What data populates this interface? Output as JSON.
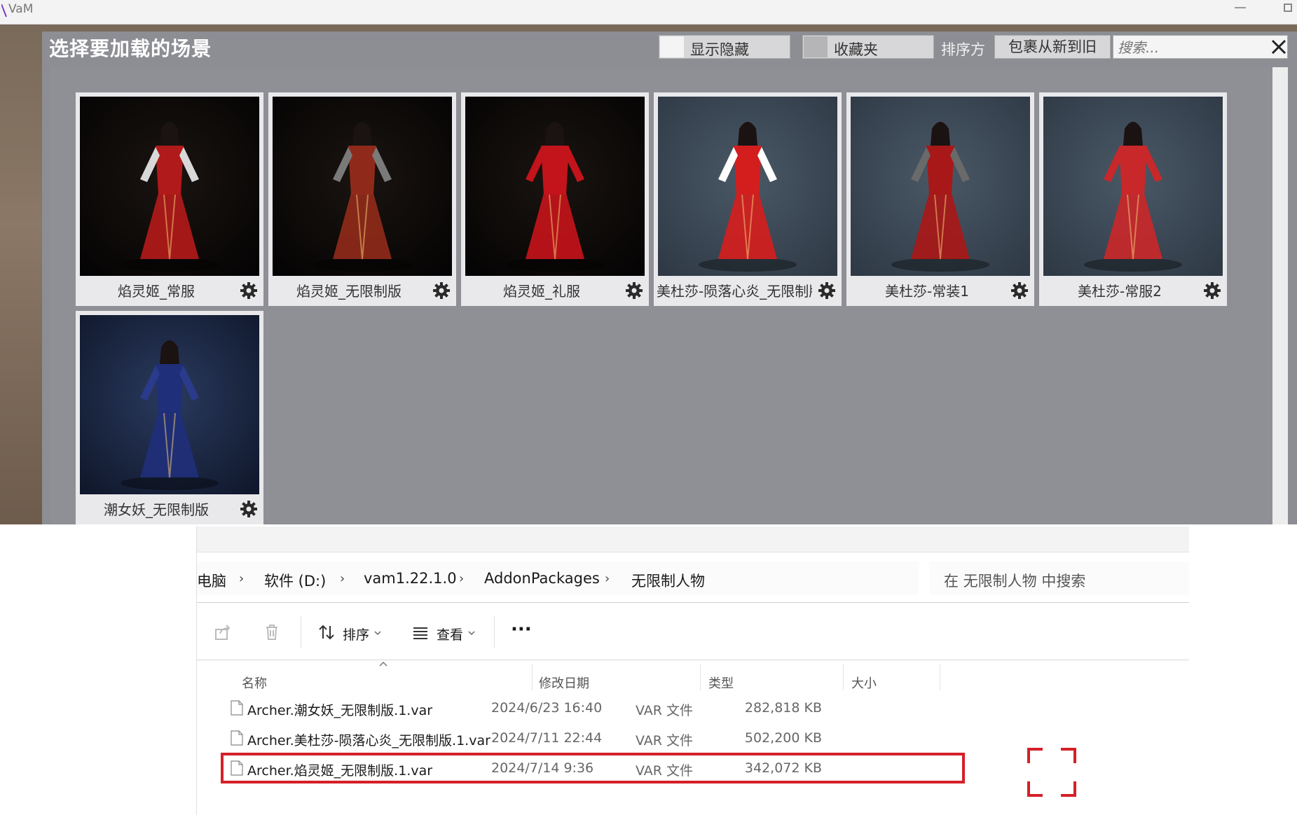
{
  "vam": {
    "window_title": "VaM",
    "panel_title": "选择要加载的场景",
    "toggles": [
      {
        "label": "显示隐藏"
      },
      {
        "label": "收藏夹"
      }
    ],
    "sort_caption": "排序方",
    "sort_value": "包裹从新到旧",
    "search_placeholder": "搜索...",
    "scenes": [
      {
        "label": "焰灵姬_常服",
        "background": "dark",
        "dress": "#b11a1a",
        "sleeve": "#d8d8d8"
      },
      {
        "label": "焰灵姬_无限制版",
        "background": "dark",
        "dress": "#8f2a1a",
        "sleeve": "#7a7a7a"
      },
      {
        "label": "焰灵姬_礼服",
        "background": "dark",
        "dress": "#c2141a",
        "sleeve": "#c2141a"
      },
      {
        "label": "美杜莎-陨落心炎_无限制版",
        "background": "slate",
        "dress": "#d41e1e",
        "sleeve": "#ffffff"
      },
      {
        "label": "美杜莎-常装1",
        "background": "slate",
        "dress": "#a81818",
        "sleeve": "#6a6a6a"
      },
      {
        "label": "美杜莎-常服2",
        "background": "slate",
        "dress": "#c8282a",
        "sleeve": "#c8282a"
      },
      {
        "label": "潮女妖_无限制版",
        "background": "navy",
        "dress": "#1f2f7a",
        "sleeve": "#2a3b8c"
      }
    ],
    "colors": {
      "panel": "#8d8e94",
      "card": "#e9e9ec"
    }
  },
  "explorer": {
    "breadcrumbs": [
      "电脑",
      "软件 (D:)",
      "vam1.22.1.0",
      "AddonPackages",
      "无限制人物"
    ],
    "search_placeholder": "在 无限制人物 中搜索",
    "toolbar": {
      "share_icon": "share-icon",
      "delete_icon": "trash-icon",
      "sort_label": "排序",
      "view_label": "查看",
      "more_label": "···"
    },
    "columns": [
      "名称",
      "修改日期",
      "类型",
      "大小"
    ],
    "files": [
      {
        "name": "Archer.潮女妖_无限制版.1.var",
        "date": "2024/6/23 16:40",
        "type": "VAR 文件",
        "size": "282,818 KB"
      },
      {
        "name": "Archer.美杜莎-陨落心炎_无限制版.1.var",
        "date": "2024/7/11 22:44",
        "type": "VAR 文件",
        "size": "502,200 KB"
      },
      {
        "name": "Archer.焰灵姬_无限制版.1.var",
        "date": "2024/7/14 9:36",
        "type": "VAR 文件",
        "size": "342,072 KB"
      }
    ],
    "highlighted_row": 2,
    "highlight_color": "#d4202a"
  }
}
